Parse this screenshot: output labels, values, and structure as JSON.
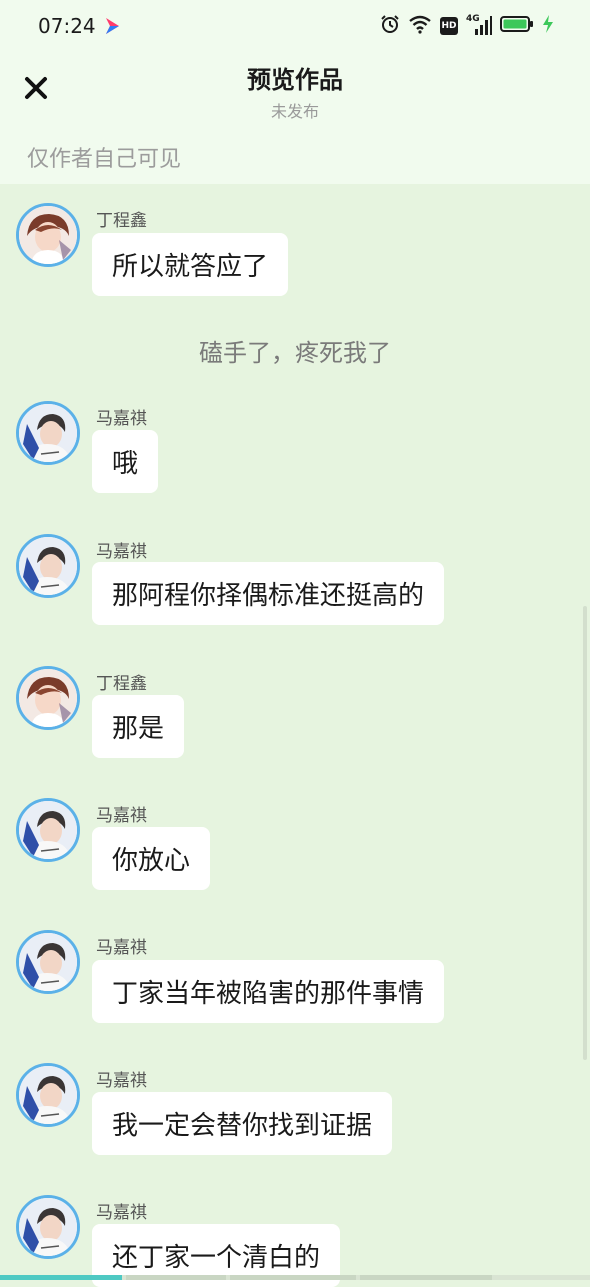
{
  "status_bar": {
    "time": "07:24",
    "network": "4G",
    "hd": "HD",
    "icons": [
      "app-logo-icon",
      "alarm-icon",
      "wifi-icon",
      "hd-icon",
      "signal-icon",
      "battery-icon",
      "charging-icon"
    ]
  },
  "header": {
    "title": "预览作品",
    "subtitle": "未发布",
    "visibility_note": "仅作者自己可见"
  },
  "colors": {
    "accent": "#5bb1e8",
    "background": "#e6f4df",
    "header_background": "#f1fbee",
    "bubble": "#ffffff"
  },
  "messages": [
    {
      "type": "message",
      "speaker": "丁程鑫",
      "avatar": "ding-avatar",
      "text": "所以就答应了"
    },
    {
      "type": "narration",
      "text": "磕手了，疼死我了"
    },
    {
      "type": "message",
      "speaker": "马嘉祺",
      "avatar": "ma-avatar",
      "text": "哦"
    },
    {
      "type": "message",
      "speaker": "马嘉祺",
      "avatar": "ma-avatar",
      "text": "那阿程你择偶标准还挺高的"
    },
    {
      "type": "message",
      "speaker": "丁程鑫",
      "avatar": "ding-avatar",
      "text": "那是"
    },
    {
      "type": "message",
      "speaker": "马嘉祺",
      "avatar": "ma-avatar",
      "text": "你放心"
    },
    {
      "type": "message",
      "speaker": "马嘉祺",
      "avatar": "ma-avatar",
      "text": "丁家当年被陷害的那件事情"
    },
    {
      "type": "message",
      "speaker": "马嘉祺",
      "avatar": "ma-avatar",
      "text": "我一定会替你找到证据"
    },
    {
      "type": "message",
      "speaker": "马嘉祺",
      "avatar": "ma-avatar",
      "text": "还丁家一个清白的"
    }
  ]
}
